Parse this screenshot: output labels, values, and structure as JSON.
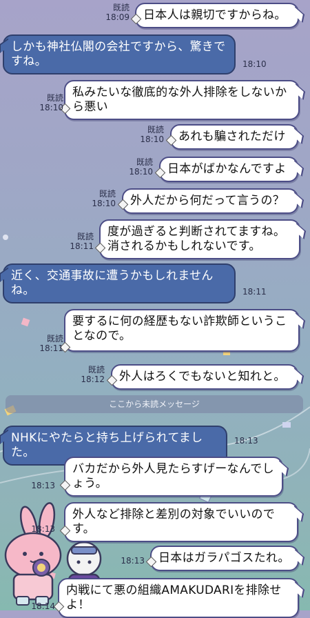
{
  "read_label": "既読",
  "messages": [
    {
      "side": "out",
      "text": "日本人は親切ですからね。",
      "time": "18:09"
    },
    {
      "side": "in",
      "text": "しかも神社仏閣の会社ですから、驚きですね。",
      "time": "18:10"
    },
    {
      "side": "out",
      "text": "私みたいな徹底的な外人排除をしないから悪い",
      "time": "18:10"
    },
    {
      "side": "out",
      "text": "あれも騙されただけ",
      "time": "18:10"
    },
    {
      "side": "out",
      "text": "日本がばかなんですよ",
      "time": "18:10"
    },
    {
      "side": "out",
      "text": "外人だから何だって言うの？",
      "time": "18:10"
    },
    {
      "side": "out",
      "text": "度が過ぎると判断されてますね。消されるかもしれないです。",
      "time": "18:11"
    },
    {
      "side": "in",
      "text": "近く、交通事故に遭うかもしれませんね。",
      "time": "18:11"
    },
    {
      "side": "out",
      "text": "要するに何の経歴もない詐欺師ということなので。",
      "time": "18:11"
    },
    {
      "side": "out",
      "text": "外人はろくでもないと知れと。",
      "time": "18:12"
    },
    {
      "side": "in",
      "text": "NHKにやたらと持ち上げられてました。",
      "time": "18:13"
    },
    {
      "side": "out",
      "text": "バカだから外人見たらすげーなんでしょう。",
      "time": "18:13"
    },
    {
      "side": "out",
      "text": "外人など排除と差別の対象でいいのです。",
      "time": "18:13"
    },
    {
      "side": "out",
      "text": "日本はガラパゴスたれ。",
      "time": "18:13"
    },
    {
      "side": "out",
      "text": "内戦にて悪の組織AMAKUDARIを排除せよ！",
      "time": "18:14"
    }
  ],
  "unread_separator": "ここから未読メッセージ",
  "colors": {
    "incoming_bubble": "#4a6aa8",
    "outgoing_bubble": "#ffffff",
    "outline": "#4c4d86"
  }
}
